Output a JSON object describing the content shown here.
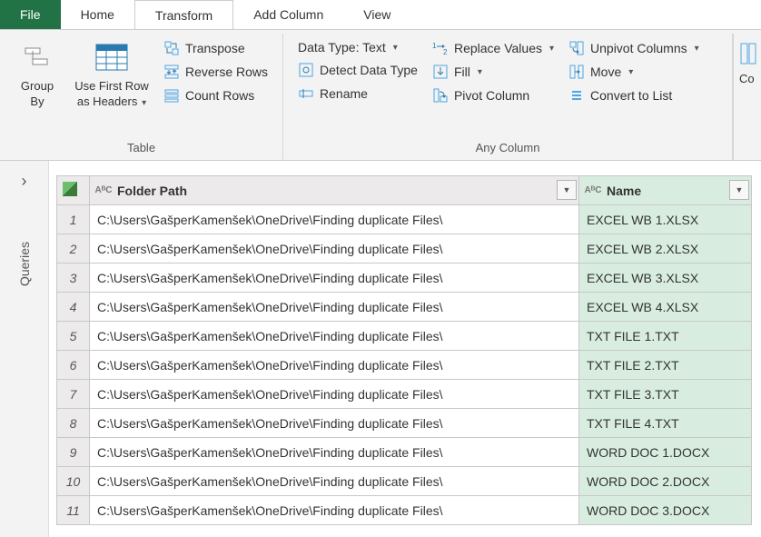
{
  "tabs": {
    "file": "File",
    "home": "Home",
    "transform": "Transform",
    "addColumn": "Add Column",
    "view": "View"
  },
  "ribbon": {
    "tableGroup": {
      "label": "Table",
      "groupBy": "Group\nBy",
      "useFirstRow": "Use First Row\nas Headers",
      "transpose": "Transpose",
      "reverseRows": "Reverse Rows",
      "countRows": "Count Rows"
    },
    "anyColGroup": {
      "label": "Any Column",
      "dataType": "Data Type: Text",
      "detect": "Detect Data Type",
      "rename": "Rename",
      "replace": "Replace Values",
      "fill": "Fill",
      "pivot": "Pivot Column",
      "unpivot": "Unpivot Columns",
      "move": "Move",
      "toList": "Convert to List"
    },
    "stub": "Co"
  },
  "side": {
    "label": "Queries"
  },
  "table": {
    "columns": {
      "folderPath": "Folder Path",
      "name": "Name"
    },
    "typeIcon": "AᴮC",
    "rows": [
      {
        "n": "1",
        "path": "C:\\Users\\GašperKamenšek\\OneDrive\\Finding duplicate Files\\",
        "name": "EXCEL WB 1.XLSX"
      },
      {
        "n": "2",
        "path": "C:\\Users\\GašperKamenšek\\OneDrive\\Finding duplicate Files\\",
        "name": "EXCEL WB 2.XLSX"
      },
      {
        "n": "3",
        "path": "C:\\Users\\GašperKamenšek\\OneDrive\\Finding duplicate Files\\",
        "name": "EXCEL WB 3.XLSX"
      },
      {
        "n": "4",
        "path": "C:\\Users\\GašperKamenšek\\OneDrive\\Finding duplicate Files\\",
        "name": "EXCEL WB 4.XLSX"
      },
      {
        "n": "5",
        "path": "C:\\Users\\GašperKamenšek\\OneDrive\\Finding duplicate Files\\",
        "name": "TXT FILE 1.TXT"
      },
      {
        "n": "6",
        "path": "C:\\Users\\GašperKamenšek\\OneDrive\\Finding duplicate Files\\",
        "name": "TXT FILE 2.TXT"
      },
      {
        "n": "7",
        "path": "C:\\Users\\GašperKamenšek\\OneDrive\\Finding duplicate Files\\",
        "name": "TXT FILE 3.TXT"
      },
      {
        "n": "8",
        "path": "C:\\Users\\GašperKamenšek\\OneDrive\\Finding duplicate Files\\",
        "name": "TXT FILE 4.TXT"
      },
      {
        "n": "9",
        "path": "C:\\Users\\GašperKamenšek\\OneDrive\\Finding duplicate Files\\",
        "name": "WORD DOC 1.DOCX"
      },
      {
        "n": "10",
        "path": "C:\\Users\\GašperKamenšek\\OneDrive\\Finding duplicate Files\\",
        "name": "WORD DOC 2.DOCX"
      },
      {
        "n": "11",
        "path": "C:\\Users\\GašperKamenšek\\OneDrive\\Finding duplicate Files\\",
        "name": "WORD DOC 3.DOCX"
      }
    ]
  }
}
